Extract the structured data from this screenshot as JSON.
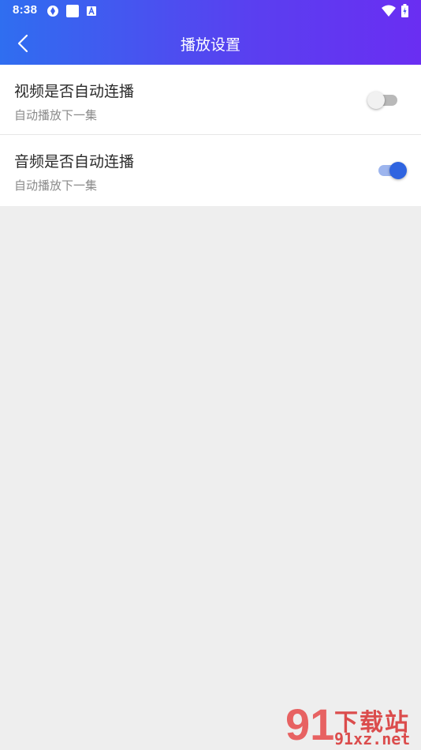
{
  "status_bar": {
    "time": "8:38",
    "icons": [
      "sync-icon",
      "square-app-icon",
      "a-app-icon",
      "wifi-icon",
      "battery-charging-icon"
    ]
  },
  "header": {
    "title": "播放设置",
    "back_icon": "chevron-left-icon"
  },
  "settings": [
    {
      "title": "视频是否自动连播",
      "subtitle": "自动播放下一集",
      "enabled": false
    },
    {
      "title": "音频是否自动连播",
      "subtitle": "自动播放下一集",
      "enabled": true
    }
  ],
  "colors": {
    "header_start": "#2f6ef0",
    "header_end": "#6a2ef2",
    "toggle_on": "#2f64e0",
    "toggle_off": "#b9b9b9",
    "background": "#eeeeee"
  },
  "watermark": {
    "number": "91",
    "title": "下载站",
    "site": "91xz.net"
  }
}
